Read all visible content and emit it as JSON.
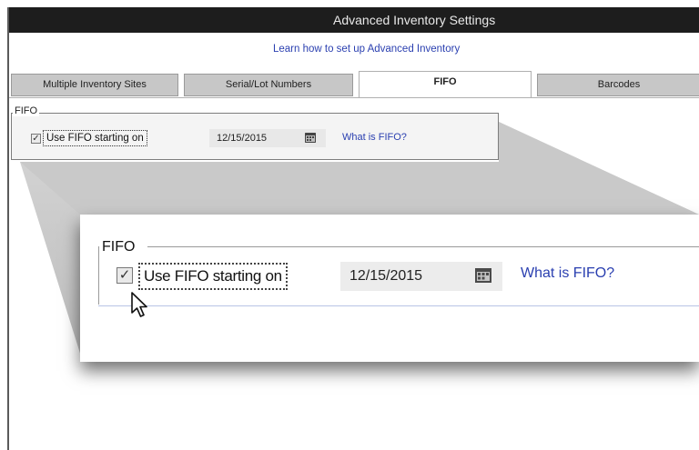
{
  "window": {
    "title": "Advanced Inventory Settings"
  },
  "help_link": "Learn how to set up Advanced Inventory",
  "tabs": [
    {
      "label": "Multiple Inventory Sites",
      "active": false
    },
    {
      "label": "Serial/Lot Numbers",
      "active": false
    },
    {
      "label": "FIFO",
      "active": true
    },
    {
      "label": "Barcodes",
      "active": false
    }
  ],
  "fifo": {
    "group_label": "FIFO",
    "checkbox_label": "Use FIFO starting on",
    "checked": true,
    "date_value": "12/15/2015",
    "help_link": "What is FIFO?"
  },
  "zoom": {
    "group_label": "FIFO",
    "checkbox_label": "Use FIFO starting on",
    "checked": true,
    "date_value": "12/15/2015",
    "help_link": "What is FIFO?"
  },
  "icons": {
    "calendar": "calendar-icon",
    "check": "checkmark-icon",
    "cursor": "mouse-pointer-icon"
  },
  "colors": {
    "titlebar": "#1d1d1d",
    "link": "#2a3fb0",
    "tab_inactive": "#c7c7c7",
    "tab_active": "#ffffff"
  }
}
